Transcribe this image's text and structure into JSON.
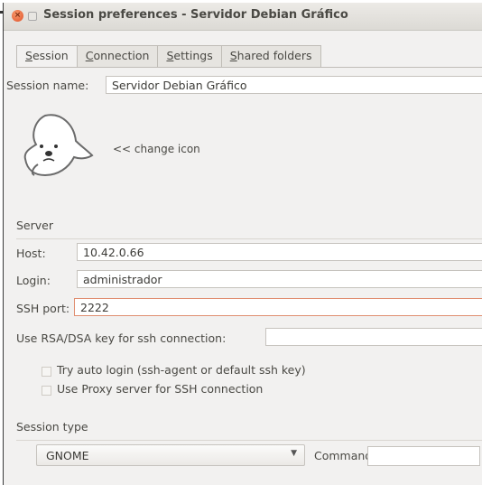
{
  "window": {
    "title": "Session preferences - Servidor Debian Gráfico",
    "close_glyph": "×"
  },
  "tabs": [
    {
      "label": "Session",
      "mnemonic_index": 0
    },
    {
      "label": "Connection",
      "mnemonic_index": 0
    },
    {
      "label": "Settings",
      "mnemonic_index": 0
    },
    {
      "label": "Shared folders",
      "mnemonic_index": 0
    }
  ],
  "session_name": {
    "label": "Session name:",
    "value": "Servidor Debian Gráfico"
  },
  "icon": {
    "name": "seal-icon",
    "change_label": "<< change icon"
  },
  "server": {
    "section_label": "Server",
    "host_label": "Host:",
    "host_value": "10.42.0.66",
    "login_label": "Login:",
    "login_value": "administrador",
    "ssh_port_label": "SSH port:",
    "ssh_port_value": "2222",
    "rsa_label": "Use RSA/DSA key for ssh connection:",
    "rsa_value": "",
    "auto_login_label": "Try auto login (ssh-agent or default ssh key)",
    "proxy_label": "Use Proxy server for SSH connection"
  },
  "session_type": {
    "section_label": "Session type",
    "selected": "GNOME",
    "command_label": "Command:",
    "command_value": ""
  },
  "colors": {
    "accent_close": "#e0522a",
    "focus_border": "#e08e70"
  }
}
